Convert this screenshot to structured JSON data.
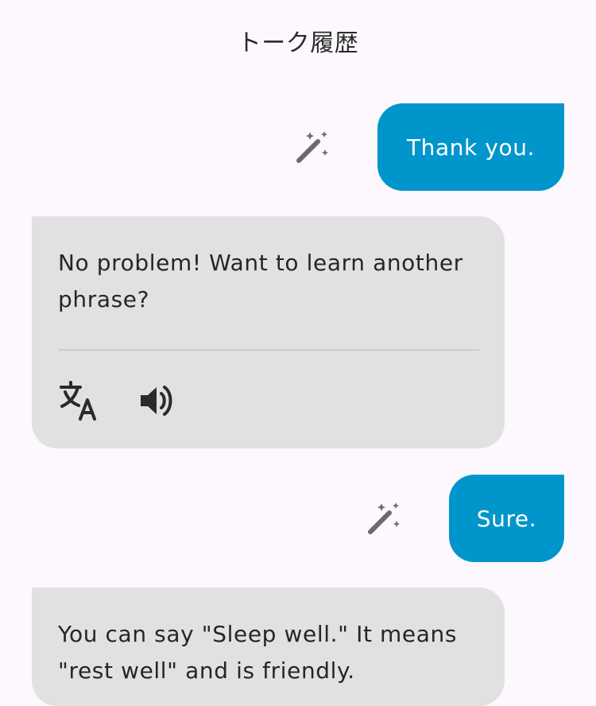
{
  "header": {
    "title": "トーク履歴"
  },
  "messages": [
    {
      "role": "user",
      "text": "Thank you."
    },
    {
      "role": "assistant",
      "text": "No problem! Want to learn another phrase?"
    },
    {
      "role": "user",
      "text": "Sure."
    },
    {
      "role": "assistant",
      "text": "You can say \"Sleep well.\" It means \"rest well\" and is friendly."
    }
  ],
  "icons": {
    "wand": "magic-wand-icon",
    "translate": "translate-icon",
    "speaker": "speaker-icon"
  },
  "colors": {
    "background": "#fdf8fd",
    "user_bubble": "#0096cc",
    "assistant_bubble": "#e1e1e1",
    "icon": "#6b6b6b",
    "action_icon": "#2b2b2b"
  }
}
